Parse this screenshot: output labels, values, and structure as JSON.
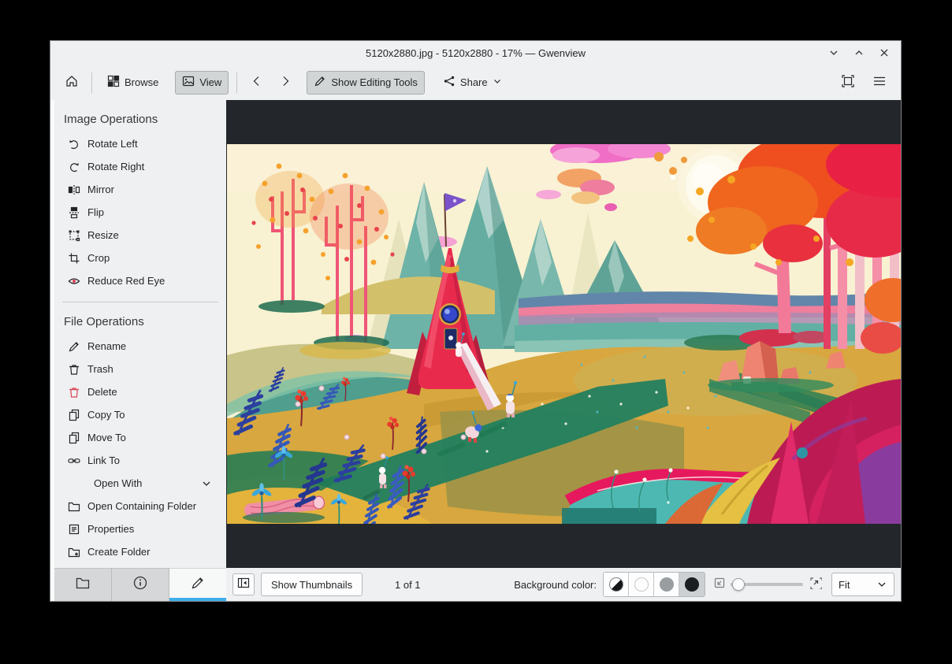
{
  "window": {
    "title": "5120x2880.jpg - 5120x2880 - 17% — Gwenview"
  },
  "toolbar": {
    "browse": "Browse",
    "view": "View",
    "show_editing_tools": "Show Editing Tools",
    "share": "Share"
  },
  "sidebar": {
    "image_operations": {
      "header": "Image Operations",
      "items": [
        {
          "label": "Rotate Left"
        },
        {
          "label": "Rotate Right"
        },
        {
          "label": "Mirror"
        },
        {
          "label": "Flip"
        },
        {
          "label": "Resize"
        },
        {
          "label": "Crop"
        },
        {
          "label": "Reduce Red Eye"
        }
      ]
    },
    "file_operations": {
      "header": "File Operations",
      "items": [
        {
          "label": "Rename"
        },
        {
          "label": "Trash"
        },
        {
          "label": "Delete"
        },
        {
          "label": "Copy To"
        },
        {
          "label": "Move To"
        },
        {
          "label": "Link To"
        }
      ],
      "open_with": {
        "label": "Open With"
      },
      "items2": [
        {
          "label": "Open Containing Folder"
        },
        {
          "label": "Properties"
        },
        {
          "label": "Create Folder"
        }
      ]
    }
  },
  "statusbar": {
    "show_thumbnails": "Show Thumbnails",
    "counter": "1 of 1",
    "background_label": "Background color:",
    "zoom_mode": "Fit"
  },
  "colors": {
    "accent": "#3daee9",
    "danger": "#da4453",
    "viewer_bg": "#23272b"
  }
}
